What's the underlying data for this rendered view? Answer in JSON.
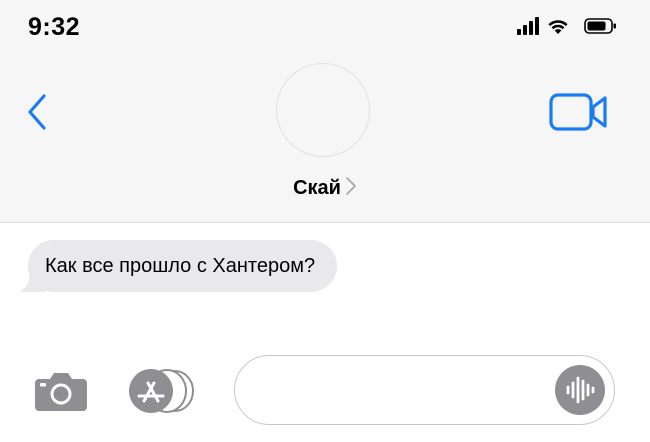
{
  "status_bar": {
    "time": "9:32",
    "icons": [
      "cellular-signal-icon",
      "wifi-icon",
      "battery-icon"
    ]
  },
  "header": {
    "back_icon": "chevron-left-icon",
    "video_icon": "video-camera-icon",
    "contact_name": "Скай",
    "contact_chevron_icon": "chevron-right-icon"
  },
  "messages": [
    {
      "direction": "incoming",
      "text": "Как все прошло с Хантером?"
    }
  ],
  "input_bar": {
    "camera_icon": "camera-icon",
    "apps_icon": "app-store-icon",
    "message_value": "",
    "audio_icon": "waveform-icon"
  },
  "colors": {
    "accent": "#1a7cf5",
    "header_bg": "#f6f6f6",
    "bubble_bg": "#e9e9eb",
    "icon_gray": "#8e8e93"
  }
}
